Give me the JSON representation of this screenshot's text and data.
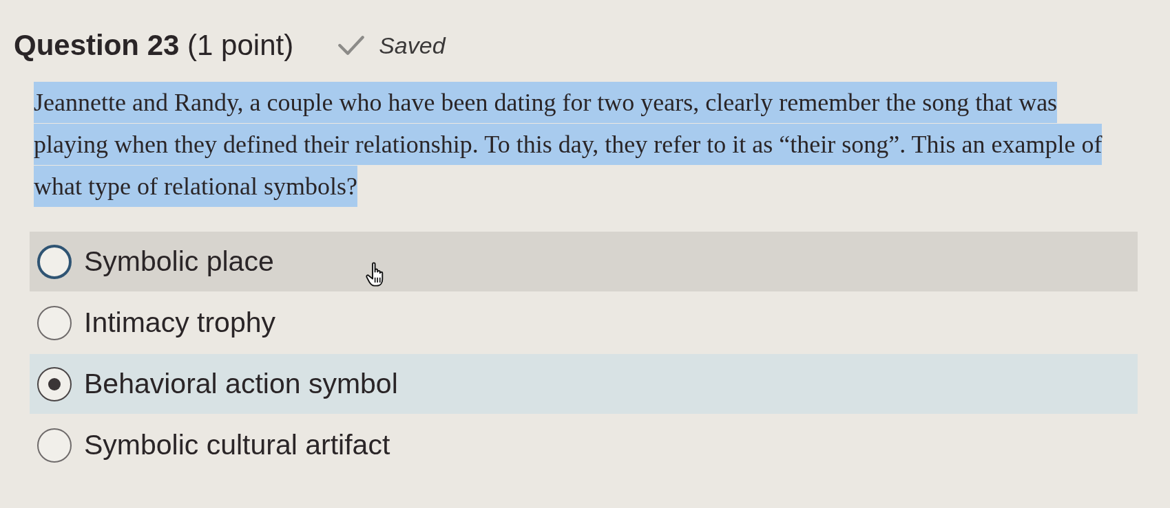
{
  "heading": {
    "title": "Question 23",
    "points": "(1 point)",
    "status": "Saved"
  },
  "question": {
    "text": "Jeannette and Randy, a couple who have been dating for two years, clearly remember the song that was playing when they defined their relationship. To this day, they refer to it as “their song”. This an example of what type of relational symbols?",
    "highlighted": true
  },
  "options": [
    {
      "label": "Symbolic place",
      "selected": false,
      "focused": true
    },
    {
      "label": "Intimacy trophy",
      "selected": false,
      "focused": false
    },
    {
      "label": "Behavioral action symbol",
      "selected": true,
      "focused": false
    },
    {
      "label": "Symbolic cultural artifact",
      "selected": false,
      "focused": false
    }
  ]
}
